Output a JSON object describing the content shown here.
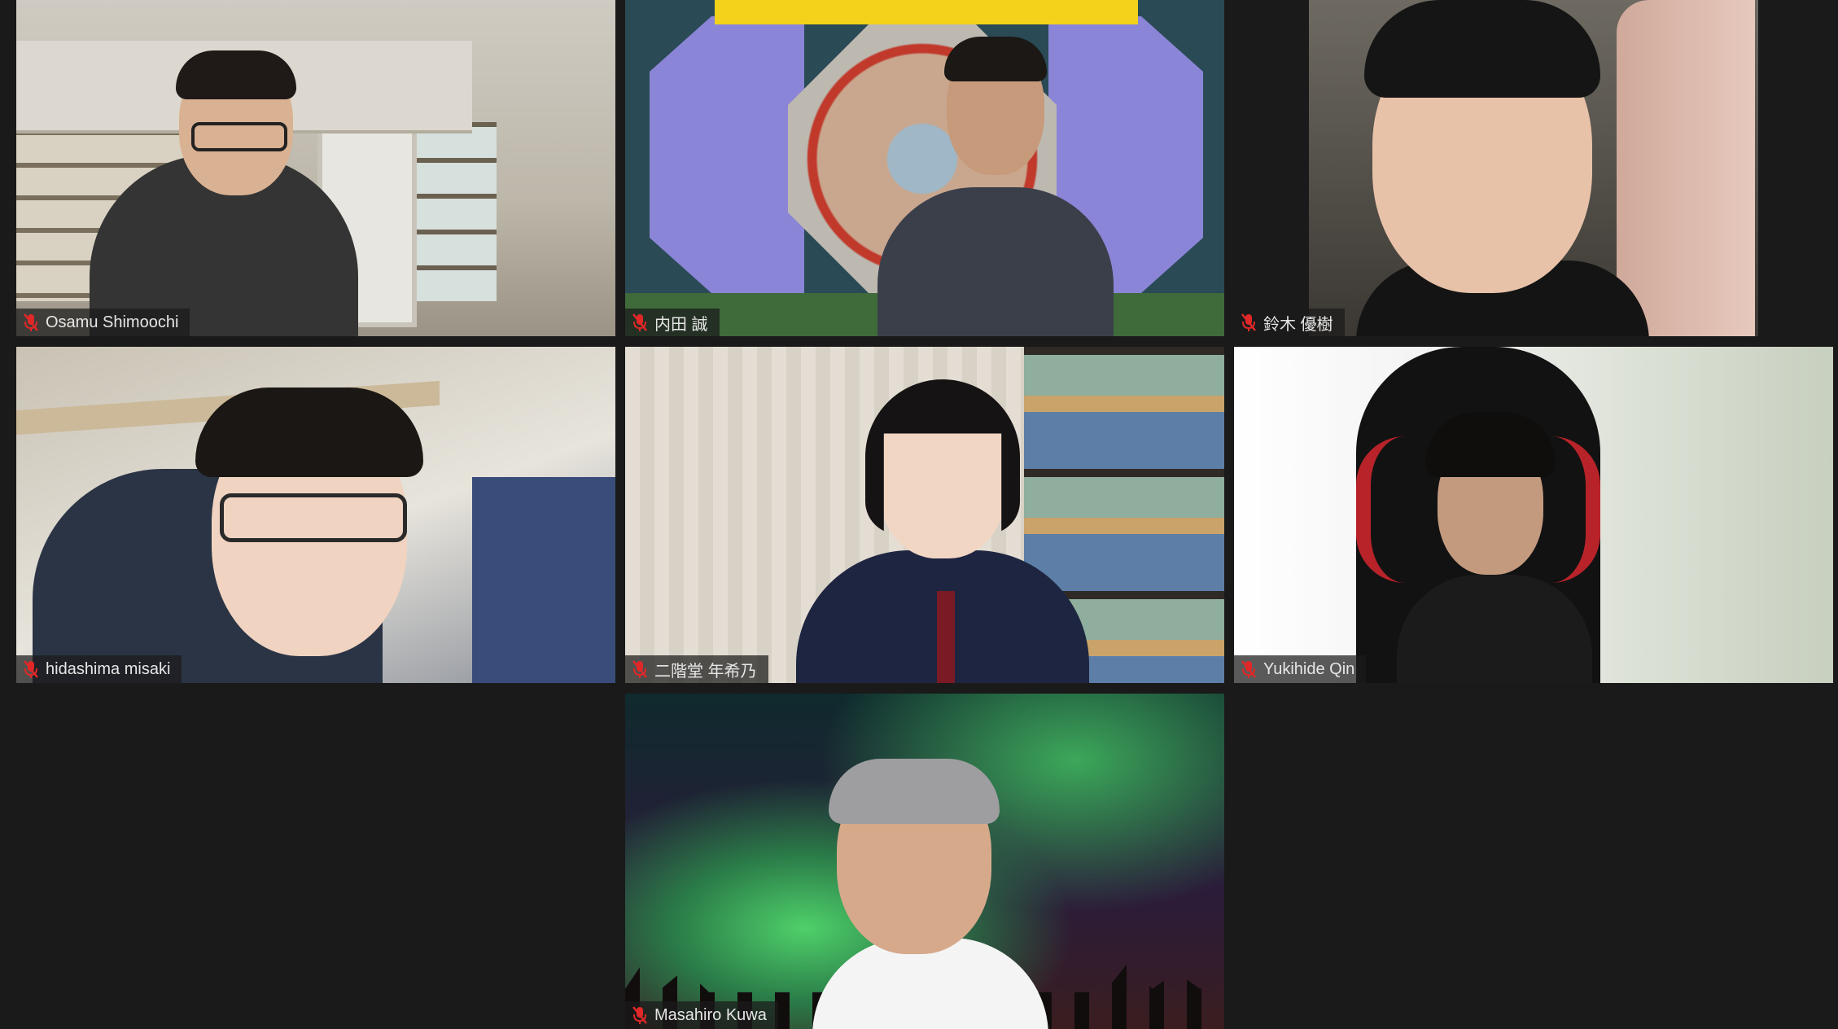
{
  "meeting": {
    "colors": {
      "background": "#1a1a1a",
      "muted_mic": "#e02828",
      "nametag_bg": "rgba(26,26,26,0.72)"
    },
    "participants": [
      {
        "name": "Osamu Shimoochi",
        "mic": "muted-mic-icon"
      },
      {
        "name": "内田 誠",
        "mic": "muted-mic-icon"
      },
      {
        "name": "鈴木 優樹",
        "mic": "muted-mic-icon"
      },
      {
        "name": "hidashima misaki",
        "mic": "muted-mic-icon"
      },
      {
        "name": "二階堂 年希乃",
        "mic": "muted-mic-icon"
      },
      {
        "name": "Yukihide Qin",
        "mic": "muted-mic-icon"
      },
      {
        "name": "Masahiro Kuwa",
        "mic": "muted-mic-icon"
      }
    ]
  }
}
